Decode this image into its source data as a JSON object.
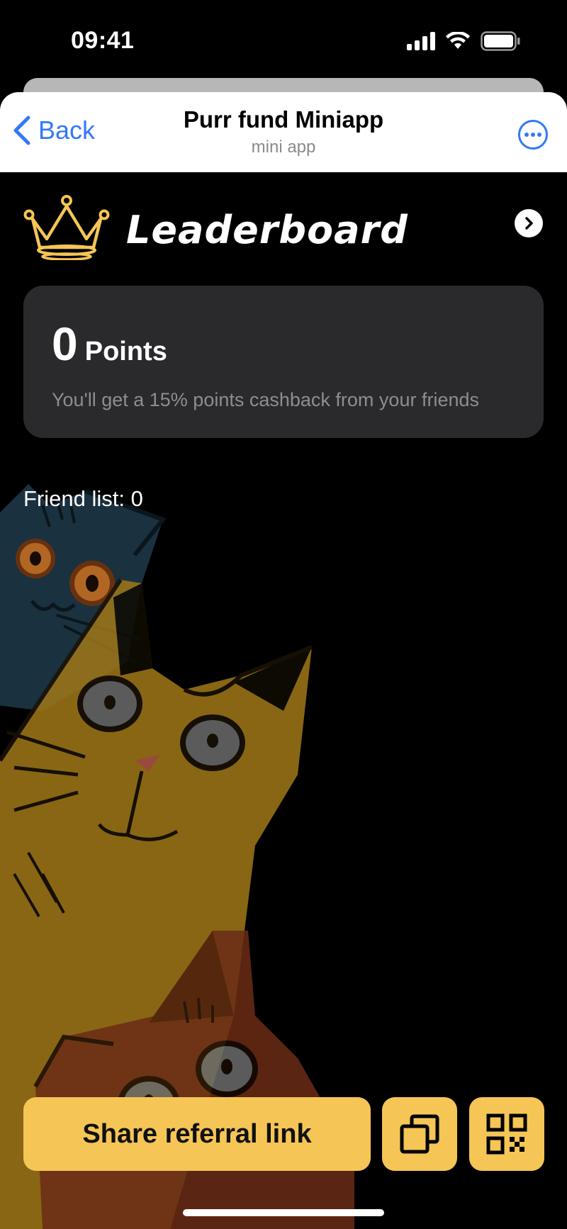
{
  "status_bar": {
    "time": "09:41",
    "icons": [
      "signal-icon",
      "wifi-icon",
      "battery-icon"
    ]
  },
  "header": {
    "back_label": "Back",
    "title": "Purr fund Miniapp",
    "subtitle": "mini app",
    "more_icon": "more-icon"
  },
  "leaderboard": {
    "title": "Leaderboard",
    "crown_icon": "crown-icon",
    "arrow_icon": "chevron-right-icon"
  },
  "points_card": {
    "value": "0",
    "label": "Points",
    "note": "You'll get a 15% points cashback from your friends"
  },
  "friends": {
    "label": "Friend list: 0"
  },
  "actions": {
    "share_label": "Share referral link",
    "copy_icon": "copy-icon",
    "qr_icon": "qr-code-icon"
  },
  "colors": {
    "accent": "#f5c556",
    "link_blue": "#3478f6",
    "card_bg": "#2a2a2c",
    "background": "#000000"
  }
}
